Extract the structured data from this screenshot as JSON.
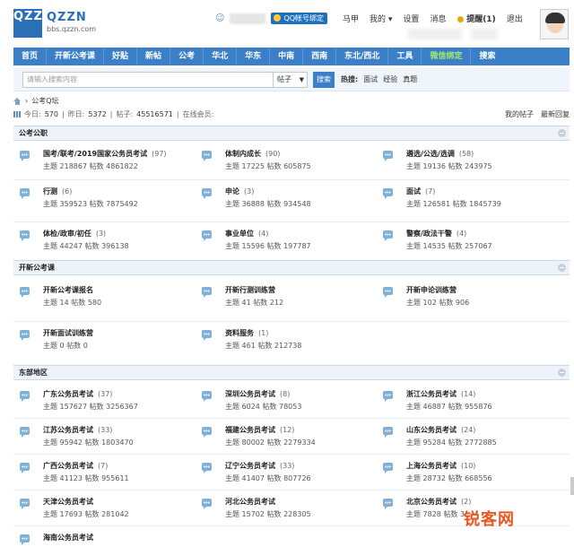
{
  "header": {
    "logo_text": "QZZN",
    "site_name": "QZZN",
    "site_url": "bbs.qzzn.com",
    "qq_bind": "QQ帐号绑定",
    "user_name": "马甲",
    "user_links": [
      {
        "label": "马甲"
      },
      {
        "label": "我的"
      },
      {
        "label": "设置"
      },
      {
        "label": "消息"
      },
      {
        "label": "提醒(1)"
      },
      {
        "label": "退出"
      }
    ]
  },
  "nav": {
    "items": [
      "首页",
      "开新公考课",
      "好贴",
      "新帖",
      "公考",
      "华北",
      "华东",
      "中南",
      "西南",
      "东北/西北",
      "工具",
      "微信绑定",
      "搜索"
    ]
  },
  "search": {
    "placeholder": "请输入搜索内容",
    "select_value": "帖子",
    "button": "搜索",
    "hot_label": "热搜:",
    "hot_items": [
      "面试",
      "经验",
      "真题"
    ]
  },
  "breadcrumb": {
    "current": "公考Q坛"
  },
  "stats": {
    "today_label": "今日:",
    "today": "570",
    "yesterday_label": "昨日:",
    "yesterday": "5372",
    "posts_label": "帖子:",
    "posts": "45516571",
    "online_label": "在线会员:",
    "my_posts": "我的帖子",
    "latest_reply": "最新回复"
  },
  "sections": [
    {
      "title": "公考公职",
      "forums": [
        {
          "name": "国考/联考/2019国家公务员考试",
          "count": "(97)",
          "topics": "主题 218867",
          "posts": "帖数 4861822"
        },
        {
          "name": "体制内成长",
          "count": "(90)",
          "topics": "主题 17225",
          "posts": "帖数 605875"
        },
        {
          "name": "遴选/公选/选调",
          "count": "(58)",
          "topics": "主题 19136",
          "posts": "帖数 243975"
        },
        {
          "name": "行测",
          "count": "(6)",
          "topics": "主题 359523",
          "posts": "帖数 7875492"
        },
        {
          "name": "申论",
          "count": "(3)",
          "topics": "主题 36888",
          "posts": "帖数 934548"
        },
        {
          "name": "面试",
          "count": "(7)",
          "topics": "主题 126581",
          "posts": "帖数 1845739"
        },
        {
          "name": "体检/政审/初任",
          "count": "(3)",
          "topics": "主题 44247",
          "posts": "帖数 396138"
        },
        {
          "name": "事业单位",
          "count": "(4)",
          "topics": "主题 15596",
          "posts": "帖数 197787"
        },
        {
          "name": "警察/政法干警",
          "count": "(4)",
          "topics": "主题 14535",
          "posts": "帖数 257067"
        }
      ]
    },
    {
      "title": "开新公考课",
      "forums": [
        {
          "name": "开新公考课报名",
          "count": "",
          "topics": "主题 14",
          "posts": "帖数 580"
        },
        {
          "name": "开新行测训练营",
          "count": "",
          "topics": "主题 41",
          "posts": "帖数 212"
        },
        {
          "name": "开新申论训练营",
          "count": "",
          "topics": "主题 102",
          "posts": "帖数 906"
        },
        {
          "name": "开新面试训练营",
          "count": "",
          "topics": "主题 0",
          "posts": "帖数 0"
        },
        {
          "name": "资料服务",
          "count": "(1)",
          "topics": "主题 461",
          "posts": "帖数 212738"
        }
      ]
    },
    {
      "title": "东部地区",
      "forums": [
        {
          "name": "广东公务员考试",
          "count": "(37)",
          "topics": "主题 157627",
          "posts": "帖数 3256367"
        },
        {
          "name": "深圳公务员考试",
          "count": "(8)",
          "topics": "主题 6024",
          "posts": "帖数 78053"
        },
        {
          "name": "浙江公务员考试",
          "count": "(14)",
          "topics": "主题 46887",
          "posts": "帖数 955876"
        },
        {
          "name": "江苏公务员考试",
          "count": "(33)",
          "topics": "主题 95942",
          "posts": "帖数 1803470"
        },
        {
          "name": "福建公务员考试",
          "count": "(12)",
          "topics": "主题 80002",
          "posts": "帖数 2279334"
        },
        {
          "name": "山东公务员考试",
          "count": "(24)",
          "topics": "主题 95284",
          "posts": "帖数 2772885"
        },
        {
          "name": "广西公务员考试",
          "count": "(7)",
          "topics": "主题 41123",
          "posts": "帖数 955611"
        },
        {
          "name": "辽宁公务员考试",
          "count": "(33)",
          "topics": "主题 41407",
          "posts": "帖数 807726"
        },
        {
          "name": "上海公务员考试",
          "count": "(10)",
          "topics": "主题 28732",
          "posts": "帖数 668556"
        },
        {
          "name": "天津公务员考试",
          "count": "",
          "topics": "主题 17693",
          "posts": "帖数 281042"
        },
        {
          "name": "河北公务员考试",
          "count": "",
          "topics": "主题 15702",
          "posts": "帖数 228305"
        },
        {
          "name": "北京公务员考试",
          "count": "(2)",
          "topics": "主题 7828",
          "posts": "帖数 3"
        },
        {
          "name": "海南公务员考试",
          "count": "",
          "topics": "",
          "posts": ""
        }
      ]
    }
  ],
  "watermark": "锐客网"
}
